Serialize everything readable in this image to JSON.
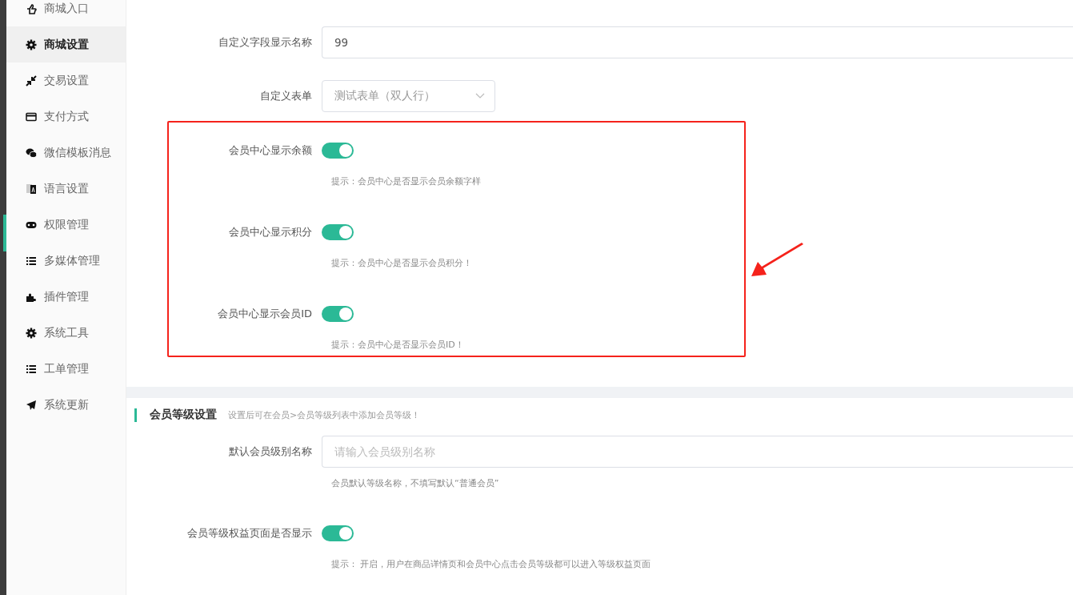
{
  "sidebar": {
    "items": [
      {
        "label": "商城入口",
        "selected": false
      },
      {
        "label": "商城设置",
        "selected": true
      },
      {
        "label": "交易设置",
        "selected": false
      },
      {
        "label": "支付方式",
        "selected": false
      },
      {
        "label": "微信模板消息",
        "selected": false
      },
      {
        "label": "语言设置",
        "selected": false
      },
      {
        "label": "权限管理",
        "selected": false
      },
      {
        "label": "多媒体管理",
        "selected": false
      },
      {
        "label": "插件管理",
        "selected": false
      },
      {
        "label": "系统工具",
        "selected": false
      },
      {
        "label": "工单管理",
        "selected": false
      },
      {
        "label": "系统更新",
        "selected": false
      }
    ]
  },
  "form": {
    "fields": [
      {
        "kind": "input",
        "label": "自定义字段显示名称",
        "value": "99"
      },
      {
        "kind": "select",
        "label": "自定义表单",
        "value": "测试表单（双人行）"
      },
      {
        "kind": "toggle",
        "label": "会员中心显示余额",
        "on": true,
        "hint": "提示：会员中心是否显示会员余额字样"
      },
      {
        "kind": "toggle",
        "label": "会员中心显示积分",
        "on": true,
        "hint": "提示：会员中心是否显示会员积分！"
      },
      {
        "kind": "toggle",
        "label": "会员中心显示会员ID",
        "on": true,
        "hint": "提示：会员中心是否显示会员ID！"
      }
    ]
  },
  "member_level_section": {
    "title": "会员等级设置",
    "subtitle": "设置后可在会员>会员等级列表中添加会员等级！",
    "fields": [
      {
        "kind": "input",
        "label": "默认会员级别名称",
        "placeholder": "请输入会员级别名称",
        "hint": "会员默认等级名称，不填写默认“普通会员”"
      },
      {
        "kind": "toggle",
        "label": "会员等级权益页面是否显示",
        "on": true,
        "hint": "提示： 开启，用户在商品详情页和会员中心点击会员等级都可以进入等级权益页面"
      }
    ]
  }
}
